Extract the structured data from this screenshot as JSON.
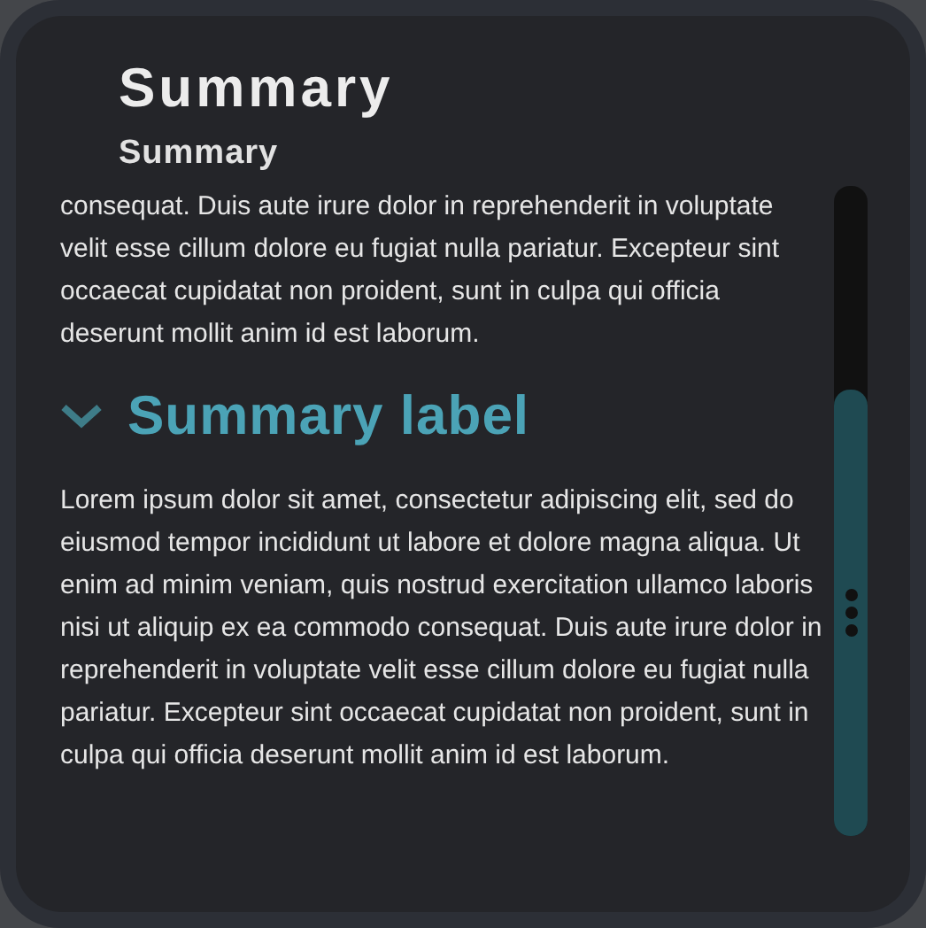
{
  "header": {
    "title": "Summary",
    "subtitle": "Summary"
  },
  "intro_text": "consequat. Duis aute irure dolor in reprehenderit in voluptate velit esse cillum dolore eu fugiat nulla pariatur. Excepteur sint occaecat cupidatat non proident, sunt in culpa qui officia deserunt mollit anim id est laborum.",
  "section": {
    "label": "Summary label",
    "expanded": true,
    "text": "Lorem ipsum dolor sit amet, consectetur adipiscing elit, sed do eiusmod tempor incididunt ut labore et dolore magna aliqua. Ut enim ad minim veniam, quis nostrud exercitation ullamco laboris nisi ut aliquip ex ea commodo consequat. Duis aute irure dolor in reprehenderit in voluptate velit esse cillum dolore eu fugiat nulla pariatur. Excepteur sint occaecat cupidatat non proident, sunt in culpa qui officia deserunt mollit anim id est laborum."
  }
}
